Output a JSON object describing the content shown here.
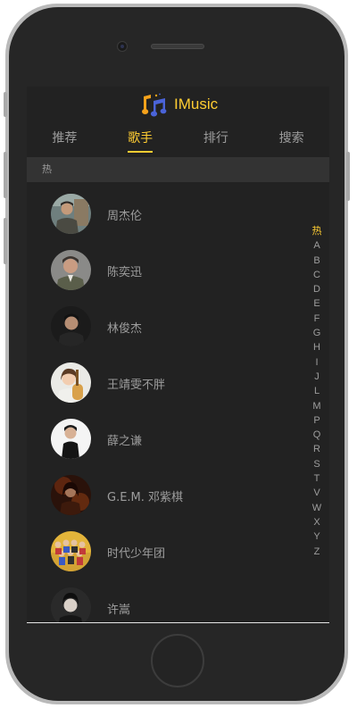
{
  "app": {
    "title": "IMusic"
  },
  "tabs": [
    {
      "label": "推荐",
      "active": false
    },
    {
      "label": "歌手",
      "active": true
    },
    {
      "label": "排行",
      "active": false
    },
    {
      "label": "搜索",
      "active": false
    }
  ],
  "group": {
    "title": "热"
  },
  "singers": [
    {
      "name": "周杰伦",
      "avatar": "avatar-jay-chou"
    },
    {
      "name": "陈奕迅",
      "avatar": "avatar-eason-chan"
    },
    {
      "name": "林俊杰",
      "avatar": "avatar-jj-lin"
    },
    {
      "name": "王靖雯不胖",
      "avatar": "avatar-wang-jingwen"
    },
    {
      "name": "薛之谦",
      "avatar": "avatar-joker-xue"
    },
    {
      "name": "G.E.M. 邓紫棋",
      "avatar": "avatar-gem"
    },
    {
      "name": "时代少年团",
      "avatar": "avatar-tnt"
    },
    {
      "name": "许嵩",
      "avatar": "avatar-vae"
    }
  ],
  "shortcut": {
    "items": [
      "热",
      "A",
      "B",
      "C",
      "D",
      "E",
      "F",
      "G",
      "H",
      "I",
      "J",
      "L",
      "M",
      "P",
      "Q",
      "R",
      "S",
      "T",
      "V",
      "W",
      "X",
      "Y",
      "Z"
    ],
    "current": "热"
  },
  "colors": {
    "accent": "#ffcd32",
    "background": "#222222",
    "group_header": "#333333"
  }
}
